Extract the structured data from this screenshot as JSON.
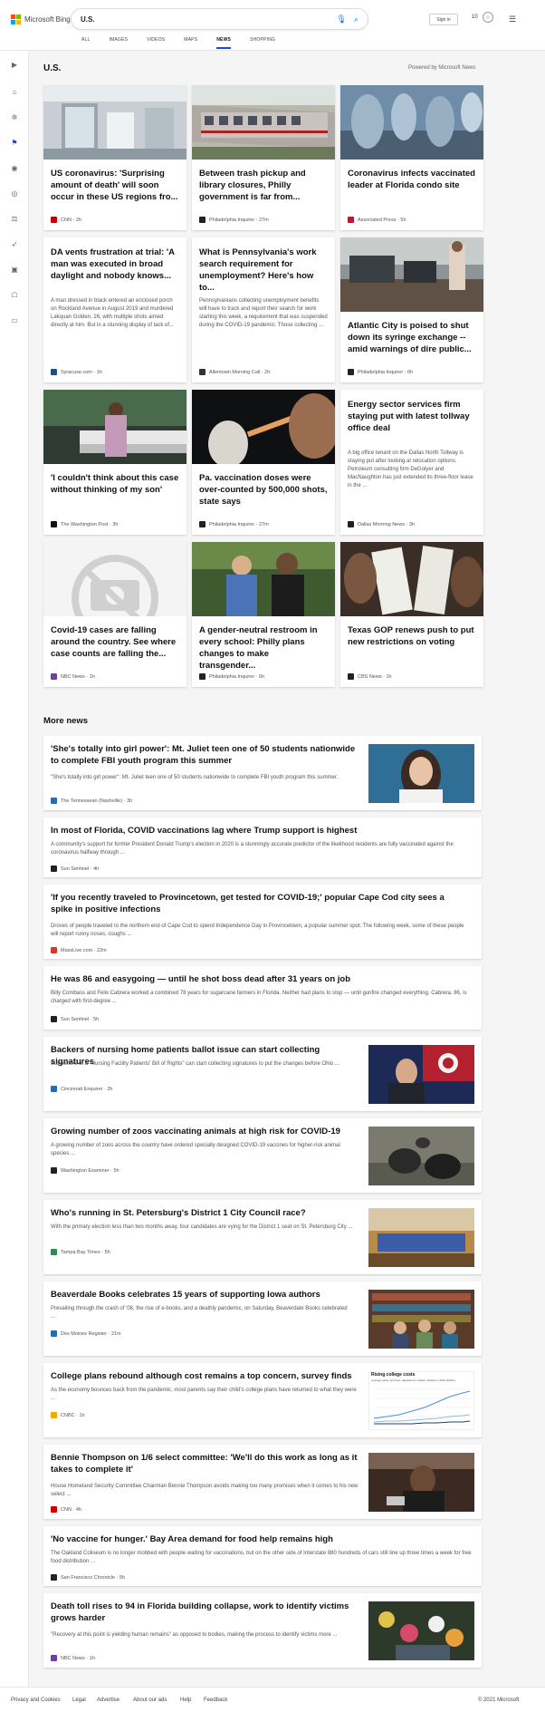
{
  "header": {
    "logo_text": "Microsoft Bing",
    "query": "U.S.",
    "signin": "Sign in",
    "points": "10"
  },
  "tabs": [
    "ALL",
    "IMAGES",
    "VIDEOS",
    "MAPS",
    "NEWS",
    "SHOPPING"
  ],
  "section": {
    "title": "U.S.",
    "powered": "Powered by Microsoft News"
  },
  "cards": [
    {
      "title": "US coronavirus: 'Surprising amount of death' will soon occur in these US regions fro...",
      "source": "CNN",
      "time": "2h",
      "logo_color": "#cc0000",
      "desc": ""
    },
    {
      "title": "Between trash pickup and library closures, Philly government is far from...",
      "source": "Philadelphia Inquirer",
      "time": "27m",
      "logo_color": "#222222",
      "desc": ""
    },
    {
      "title": "Coronavirus infects vaccinated leader at Florida condo site",
      "source": "Associated Press",
      "time": "5h",
      "logo_color": "#c4122f",
      "desc": ""
    },
    {
      "title": "DA vents frustration at trial: 'A man was executed in broad daylight and nobody knows...",
      "source": "Syracuse.com",
      "time": "1h",
      "logo_color": "#1f4e8c",
      "desc": "A man dressed in black entered an enclosed porch on Rockland Avenue in August 2019 and murdered Lakquan Golden, 26, with multiple shots aimed directly at him. But in a stunning display of lack of..."
    },
    {
      "title": "What is Pennsylvania's work search requirement for unemployment? Here's how to...",
      "source": "Allentown Morning Call",
      "time": "2h",
      "logo_color": "#333333",
      "desc": "Pennsylvanians collecting unemployment benefits will have to track and report their search for work starting this week, a requirement that was suspended during the COVID-19 pandemic. Those collecting ..."
    },
    {
      "title": "Atlantic City is poised to shut down its syringe exchange -- amid warnings of dire public...",
      "source": "Philadelphia Inquirer",
      "time": "6h",
      "logo_color": "#222222",
      "desc": ""
    },
    {
      "title": "'I couldn't think about this case without thinking of my son'",
      "source": "The Washington Post",
      "time": "3h",
      "logo_color": "#111111",
      "desc": ""
    },
    {
      "title": "Pa. vaccination doses were over-counted by 500,000 shots, state says",
      "source": "Philadelphia Inquirer",
      "time": "27m",
      "logo_color": "#222222",
      "desc": ""
    },
    {
      "title": "Energy sector services firm staying put with latest tollway office deal",
      "source": "Dallas Morning News",
      "time": "3h",
      "logo_color": "#222222",
      "desc": "A big office tenant on the Dallas North Tollway is staying put after looking at relocation options. Petroleum consulting firm DeGolyer and MacNaughton has just extended its three-floor lease in the ..."
    },
    {
      "title": "Covid-19 cases are falling around the country. See where case counts are falling the...",
      "source": "NBC News",
      "time": "1h",
      "logo_color": "#6e3fa3",
      "desc": ""
    },
    {
      "title": "A gender-neutral restroom in every school: Philly plans changes to make transgender...",
      "source": "Philadelphia Inquirer",
      "time": "6h",
      "logo_color": "#222222",
      "desc": ""
    },
    {
      "title": "Texas GOP renews push to put new restrictions on voting",
      "source": "CBS News",
      "time": "1h",
      "logo_color": "#222222",
      "desc": ""
    }
  ],
  "more_news_title": "More news",
  "rows": [
    {
      "title": "'She's totally into girl power': Mt. Juliet teen one of 50 students nationwide to complete FBI youth program this summer",
      "desc": "\"She's totally into girl power\": Mt. Juliet teen one of 50 students nationwide to complete FBI youth program this summer.",
      "source": "The Tennessean (Nashville)",
      "time": "3h",
      "logo_color": "#2b6cb0"
    },
    {
      "title": "In most of Florida, COVID vaccinations lag where Trump support is highest",
      "desc": "A community's support for former President Donald Trump's election in 2020 is a stunningly accurate predictor of the likelihood residents are fully vaccinated against the coronavirus halfway through ...",
      "source": "Sun Sentinel",
      "time": "4h",
      "logo_color": "#222222"
    },
    {
      "title": "'If you recently traveled to Provincetown, get tested for COVID-19;' popular Cape Cod city sees a spike in positive infections",
      "desc": "Droves of people traveled to the northern end of Cape Cod to spend Independence Day in Provincetown, a popular summer spot. The following week, some of these people will report runny noses, coughs ...",
      "source": "MassLive.com",
      "time": "22m",
      "logo_color": "#d23b2b"
    },
    {
      "title": "He was 86 and easygoing — until he shot boss dead after 31 years on job",
      "desc": "Billy Combass and Felix Cabrera worked a combined 78 years for sugarcane farmers in Florida. Neither had plans to stop — until gunfire changed everything. Cabrera, 86, is charged with first-degree ...",
      "source": "Sun Sentinel",
      "time": "5h",
      "logo_color": "#222222"
    },
    {
      "title": "Backers of nursing home patients ballot issue can start collecting signatures",
      "desc": "Supporters of a \"Nursing Facility Patients' Bill of Rights\" can start collecting signatures to put the changes before Ohio ...",
      "source": "Cincinnati Enquirer",
      "time": "2h",
      "logo_color": "#2b6cb0"
    },
    {
      "title": "Growing number of zoos vaccinating animals at high risk for COVID-19",
      "desc": "A growing number of zoos across the country have ordered specially designed COVID-19 vaccines for higher-risk animal species ...",
      "source": "Washington Examiner",
      "time": "5h",
      "logo_color": "#222222"
    },
    {
      "title": "Who's running in St. Petersburg's District 1 City Council race?",
      "desc": "With the primary election less than two months away, four candidates are vying for the District 1 seat on St. Petersburg City ...",
      "source": "Tampa Bay Times",
      "time": "5h",
      "logo_color": "#2e8b57"
    },
    {
      "title": "Beaverdale Books celebrates 15 years of supporting Iowa authors",
      "desc": "Prevailing through the crash of '08, the rise of e-books, and a deathly pandemic, on Saturday, Beaverdale Books celebrated ...",
      "source": "Des Moines Register",
      "time": "21m",
      "logo_color": "#2b6cb0"
    },
    {
      "title": "College plans rebound although cost remains a top concern, survey finds",
      "desc": "As the economy bounces back from the pandemic, most parents say their child's college plans have returned to what they were ...",
      "source": "CNBC",
      "time": "1h",
      "logo_color": "#f2a900"
    },
    {
      "title": "Bennie Thompson on 1/6 select committee: 'We'll do this work as long as it takes to complete it'",
      "desc": "House Homeland Security Committee Chairman Bennie Thompson avoids making too many promises when it comes to his new select ...",
      "source": "CNN",
      "time": "4h",
      "logo_color": "#cc0000"
    },
    {
      "title": "'No vaccine for hunger.' Bay Area demand for food help remains high",
      "desc": "The Oakland Coliseum is no longer mobbed with people waiting for vaccinations, but on the other side of Interstate 880 hundreds of cars still line up three times a week for free food distribution ...",
      "source": "San Francisco Chronicle",
      "time": "5h",
      "logo_color": "#222222"
    },
    {
      "title": "Death toll rises to 94 in Florida building collapse, work to identify victims grows harder",
      "desc": "\"Recovery at this point is yielding human remains\" as opposed to bodies, making the process to identify victims more ...",
      "source": "NBC News",
      "time": "1h",
      "logo_color": "#6e3fa3"
    }
  ],
  "chart_thumb": {
    "title": "Rising college costs",
    "subtitle": "Average tuition and fees, adjusted for inflation (dollars in 2019 dollars)"
  },
  "footer": {
    "links": [
      "Privacy and Cookies",
      "Legal",
      "Advertise",
      "About our ads",
      "Help",
      "Feedback"
    ],
    "copyright": "© 2021 Microsoft"
  }
}
